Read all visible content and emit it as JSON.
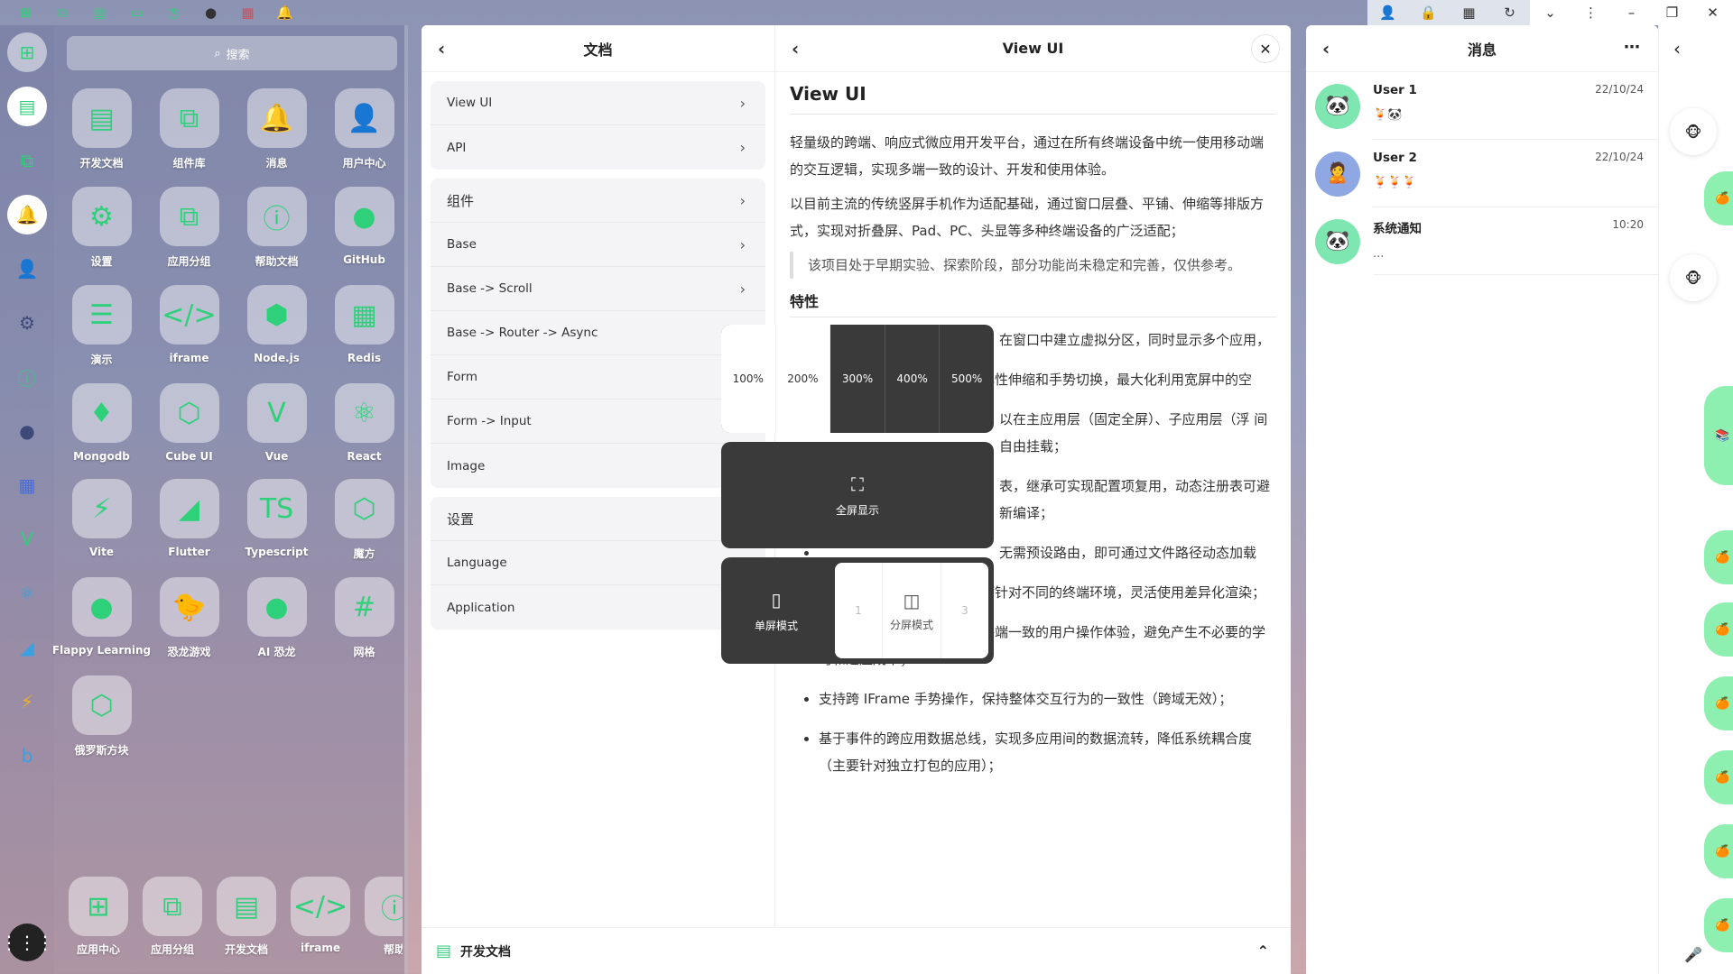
{
  "topbar": {
    "left_icons": [
      "apps-icon",
      "copy-icon",
      "doc-icon",
      "window-icon",
      "clock-icon",
      "github-icon",
      "grid-icon",
      "bell-icon"
    ],
    "right_icons": [
      "user-icon",
      "lock-icon",
      "qr-icon",
      "refresh-icon",
      "chevron-down-icon",
      "more-vertical-icon",
      "minimize-icon",
      "restore-icon",
      "close-icon"
    ]
  },
  "dock": {
    "items": [
      "apps-icon",
      "doc-icon",
      "copy-icon",
      "bell-icon",
      "user-icon",
      "gear-icon",
      "info-icon",
      "github-icon",
      "grid-icon",
      "vue-icon",
      "react-icon",
      "flutter-icon",
      "vite-icon",
      "bing-icon"
    ],
    "launcher_icon": "⋮⋮⋮"
  },
  "launcher": {
    "search_placeholder": "搜索",
    "apps": [
      {
        "label": "开发文档",
        "glyph": "▤"
      },
      {
        "label": "组件库",
        "glyph": "⧉"
      },
      {
        "label": "消息",
        "glyph": "🔔"
      },
      {
        "label": "用户中心",
        "glyph": "👤"
      },
      {
        "label": "设置",
        "glyph": "⚙"
      },
      {
        "label": "应用分组",
        "glyph": "⧉"
      },
      {
        "label": "帮助文档",
        "glyph": "ⓘ"
      },
      {
        "label": "GitHub",
        "glyph": "●"
      },
      {
        "label": "演示",
        "glyph": "☰"
      },
      {
        "label": "iframe",
        "glyph": "</>"
      },
      {
        "label": "Node.js",
        "glyph": "⬢"
      },
      {
        "label": "Redis",
        "glyph": "▦"
      },
      {
        "label": "Mongodb",
        "glyph": "♦"
      },
      {
        "label": "Cube UI",
        "glyph": "⬡"
      },
      {
        "label": "Vue",
        "glyph": "V"
      },
      {
        "label": "React",
        "glyph": "⚛"
      },
      {
        "label": "Vite",
        "glyph": "⚡"
      },
      {
        "label": "Flutter",
        "glyph": "◢"
      },
      {
        "label": "Typescript",
        "glyph": "TS"
      },
      {
        "label": "魔方",
        "glyph": "⬡"
      },
      {
        "label": "Flappy Learning",
        "glyph": "●"
      },
      {
        "label": "恐龙游戏",
        "glyph": "🐤"
      },
      {
        "label": "AI 恐龙",
        "glyph": "●"
      },
      {
        "label": "网格",
        "glyph": "#"
      },
      {
        "label": "俄罗斯方块",
        "glyph": "⬡"
      }
    ],
    "dockbar": [
      {
        "label": "应用中心",
        "glyph": "⊞"
      },
      {
        "label": "应用分组",
        "glyph": "⧉"
      },
      {
        "label": "开发文档",
        "glyph": "▤"
      },
      {
        "label": "iframe",
        "glyph": "</>"
      },
      {
        "label": "帮助",
        "glyph": "ⓘ"
      }
    ]
  },
  "docs": {
    "title": "文档",
    "group1": [
      "View UI",
      "API"
    ],
    "group2_head": "组件",
    "group2": [
      "Base",
      "Base -> Scroll",
      "Base -> Router -> Async",
      "Form",
      "Form -> Input",
      "Image"
    ],
    "group3_head": "设置",
    "group3": [
      "Language",
      "Application"
    ]
  },
  "view": {
    "title": "View UI",
    "h1": "View UI",
    "p1": "轻量级的跨端、响应式微应用开发平台，通过在所有终端设备中统一使用移动端的交互逻辑，实现多端一致的设计、开发和使用体验。",
    "p2": "以目前主流的传统竖屏手机作为适配基础，通过窗口层叠、平铺、伸缩等排版方式，实现对折叠屏、Pad、PC、头显等多种终端设备的广泛适配；",
    "quote": "该项目处于早期实验、探索阶段，部分功能尚未稳定和完善，仅供参考。",
    "h2": "特性",
    "features": [
      "在窗口中建立虚拟分区，同时显示多个应用，",
      "宽屏模式下，应用窗口支持弹性伸缩和手势切换，最大化利用宽屏中的空",
      "以在主应用层（固定全屏）、子应用层（浮 间自由挂载；",
      "表，继承可实现配置项复用，动态注册表可避 新编译；",
      "无需预设路由，即可通过文件路径动态加载",
      "支持同构或异构加载模式，可针对不同的终端环境，灵活使用差异化渲染；",
      "支持鼠标手势操作，保持多终端一致的用户操作体验，避免产生不必要的学习和适应成本；",
      "支持跨 IFrame 手势操作，保持整体交互行为的一致性（跨域无效）；",
      "基于事件的跨应用数据总线，实现多应用间的数据流转，降低系统耦合度（主要针对独立打包的应用）；"
    ]
  },
  "overlay": {
    "zoom_levels": [
      "100%",
      "200%",
      "300%",
      "400%",
      "500%"
    ],
    "fullscreen_label": "全屏显示",
    "single_label": "单屏模式",
    "split_label": "分屏模式",
    "split_left": "1",
    "split_right": "3"
  },
  "footer": {
    "label": "开发文档"
  },
  "messages": {
    "title": "消息",
    "items": [
      {
        "name": "User 1",
        "text": "🍹🐼",
        "time": "22/10/24",
        "avatar": "🐼"
      },
      {
        "name": "User 2",
        "text": "🍹🍹🍹",
        "time": "22/10/24",
        "avatar": "🙎"
      },
      {
        "name": "系统通知",
        "text": "...",
        "time": "10:20",
        "avatar": "🐼"
      }
    ]
  },
  "colors": {
    "accent": "#2fd07a",
    "overlay": "#3a3a3a",
    "bubble": "#8ef0b0"
  }
}
